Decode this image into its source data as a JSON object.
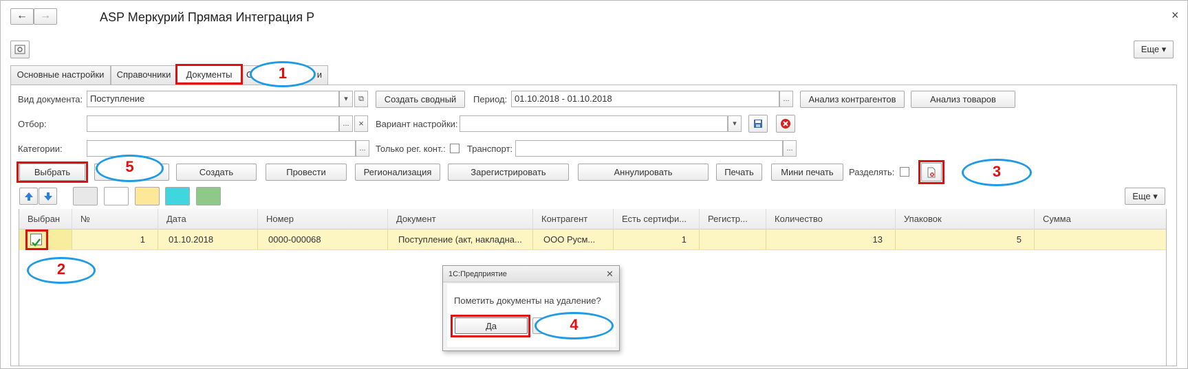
{
  "window": {
    "title": "ASP Меркурий Прямая Интеграция Р",
    "close": "×",
    "more_label": "Еще ▾"
  },
  "tabs": [
    "Основные настройки",
    "Справочники",
    "Документы",
    "С",
    "и"
  ],
  "filters": {
    "doc_type_label": "Вид документа:",
    "doc_type_value": "Поступление",
    "create_summary": "Создать сводный",
    "period_label": "Период:",
    "period_value": "01.10.2018 - 01.10.2018",
    "analysis_contractors": "Анализ контрагентов",
    "analysis_goods": "Анализ товаров",
    "selection_label": "Отбор:",
    "variant_label": "Вариант настройки:",
    "categories_label": "Категории:",
    "only_reg_label": "Только рег. конт.:",
    "transport_label": "Транспорт:",
    "dots": "...",
    "clear": "×"
  },
  "toolbar": {
    "select": "Выбрать",
    "create": "Создать",
    "post": "Провести",
    "regionalize": "Регионализация",
    "register": "Зарегистрировать",
    "cancel_docs": "Аннулировать",
    "print": "Печать",
    "mini_print": "Мини печать",
    "split_label": "Разделять:",
    "more_label": "Еще ▾"
  },
  "colors": {
    "gray": "#e8e8e8",
    "white": "#ffffff",
    "yellow": "#fde89a",
    "cyan": "#3fd6e0",
    "green": "#8fc98a",
    "row_highlight": "#fdf6c3",
    "annotation_red": "#e01010",
    "annotation_blue": "#1f9be6"
  },
  "table": {
    "columns": [
      "Выбран",
      "№",
      "Дата",
      "Номер",
      "Документ",
      "Контрагент",
      "Есть сертифи...",
      "Регистр...",
      "Количество",
      "Упаковок",
      "Сумма"
    ],
    "rows": [
      {
        "selected": true,
        "no": "1",
        "date": "01.10.2018",
        "number": "0000-000068",
        "document": "Поступление (акт, накладна...",
        "contractor": "ООО Русм...",
        "has_cert": "1",
        "reg": "",
        "qty": "13",
        "packs": "5",
        "sum": ""
      }
    ]
  },
  "dialog": {
    "title": "1С:Предприятие",
    "message": "Пометить документы на удаление?",
    "yes": "Да",
    "close": "✕"
  },
  "annotations": [
    "1",
    "2",
    "3",
    "4",
    "5"
  ]
}
